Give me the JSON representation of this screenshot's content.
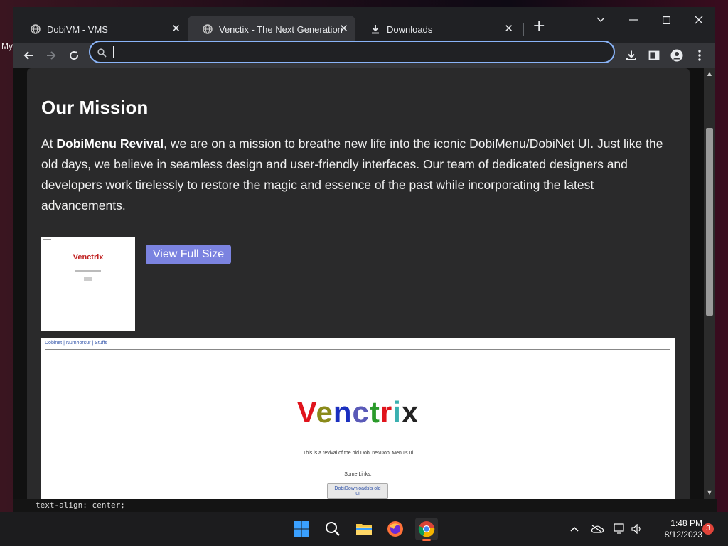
{
  "desktop": {
    "left_text": "My",
    "code_peek": "text-align: center;"
  },
  "browser": {
    "tabs": [
      {
        "title": "DobiVM - VMS",
        "icon": "globe-icon",
        "active": false
      },
      {
        "title": "Venctix - The Next Generation",
        "icon": "globe-icon",
        "active": true
      },
      {
        "title": "Downloads",
        "icon": "download-icon",
        "active": false
      }
    ],
    "address": {
      "value": "",
      "placeholder": ""
    }
  },
  "page": {
    "heading": "Our Mission",
    "mission": {
      "prefix": "At ",
      "brand": "DobiMenu Revival",
      "body": ", we are on a mission to breathe new life into the iconic DobiMenu/DobiNet UI. Just like the old days, we believe in seamless design and user-friendly interfaces. Our team of dedicated designers and developers work tirelessly to restore the magic and essence of the past while incorporating the latest advancements."
    },
    "view_button": "View Full Size",
    "thumbnail": {
      "title": "Venctrix"
    },
    "preview": {
      "nav_links": "Dobinet | Num4orsur | Stuffs",
      "title_letters": [
        {
          "ch": "V",
          "color": "#e0141c"
        },
        {
          "ch": "e",
          "color": "#8a8a1a"
        },
        {
          "ch": "n",
          "color": "#1a2fbf"
        },
        {
          "ch": "c",
          "color": "#5a5ab8"
        },
        {
          "ch": "t",
          "color": "#2a9a2a"
        },
        {
          "ch": "r",
          "color": "#e0141c"
        },
        {
          "ch": "i",
          "color": "#3ab0b0"
        },
        {
          "ch": "x",
          "color": "#222222"
        }
      ],
      "subtitle": "This is a revival of the old Dobi.net/Dobi Menu's ui",
      "links_label": "Some Links:",
      "link_button": "DobiDownloads's old ui"
    }
  },
  "taskbar": {
    "time": "1:48 PM",
    "date": "8/12/2023",
    "notification_count": "3",
    "accent": "#ff6a3d"
  }
}
